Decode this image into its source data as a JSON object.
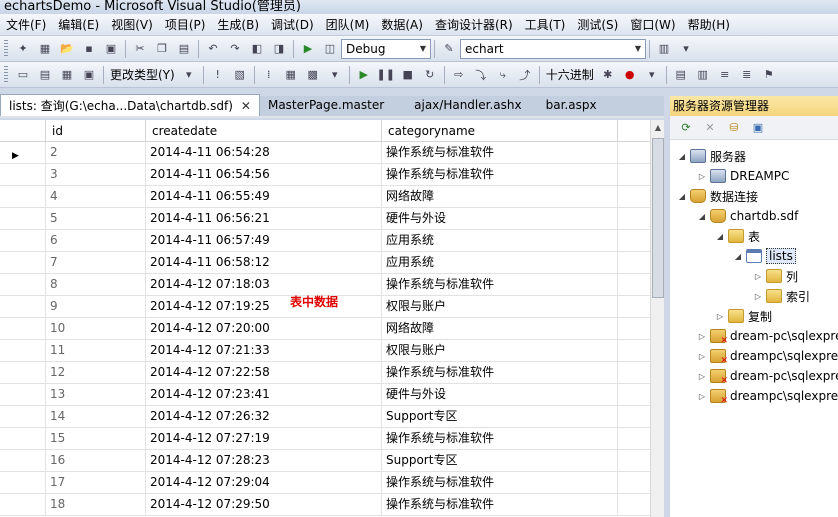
{
  "window": {
    "title": "echartsDemo - Microsoft Visual Studio(管理员)"
  },
  "menu": [
    "文件(F)",
    "编辑(E)",
    "视图(V)",
    "项目(P)",
    "生成(B)",
    "调试(D)",
    "团队(M)",
    "数据(A)",
    "查询设计器(R)",
    "工具(T)",
    "测试(S)",
    "窗口(W)",
    "帮助(H)"
  ],
  "toolbar1": {
    "config": "Debug",
    "search": "echart"
  },
  "toolbar2": {
    "change_type": "更改类型(Y)",
    "hex": "十六进制"
  },
  "tabs": [
    {
      "label": "lists: 查询(G:\\echa...Data\\chartdb.sdf)",
      "active": true,
      "close": "✕"
    },
    {
      "label": "MasterPage.master",
      "active": false
    },
    {
      "label": "ajax/Handler.ashx",
      "active": false
    },
    {
      "label": "bar.aspx",
      "active": false
    }
  ],
  "grid": {
    "columns": [
      "id",
      "createdate",
      "categoryname"
    ],
    "rows": [
      [
        "2",
        "2014-4-11 06:54:28",
        "操作系统与标准软件"
      ],
      [
        "3",
        "2014-4-11 06:54:56",
        "操作系统与标准软件"
      ],
      [
        "4",
        "2014-4-11 06:55:49",
        "网络故障"
      ],
      [
        "5",
        "2014-4-11 06:56:21",
        "硬件与外设"
      ],
      [
        "6",
        "2014-4-11 06:57:49",
        "应用系统"
      ],
      [
        "7",
        "2014-4-11 06:58:12",
        "应用系统"
      ],
      [
        "8",
        "2014-4-12 07:18:03",
        "操作系统与标准软件"
      ],
      [
        "9",
        "2014-4-12 07:19:25",
        "权限与账户"
      ],
      [
        "10",
        "2014-4-12 07:20:00",
        "网络故障"
      ],
      [
        "11",
        "2014-4-12 07:21:33",
        "权限与账户"
      ],
      [
        "12",
        "2014-4-12 07:22:58",
        "操作系统与标准软件"
      ],
      [
        "13",
        "2014-4-12 07:23:41",
        "硬件与外设"
      ],
      [
        "14",
        "2014-4-12 07:26:32",
        "Support专区"
      ],
      [
        "15",
        "2014-4-12 07:27:19",
        "操作系统与标准软件"
      ],
      [
        "16",
        "2014-4-12 07:28:23",
        "Support专区"
      ],
      [
        "17",
        "2014-4-12 07:29:04",
        "操作系统与标准软件"
      ],
      [
        "18",
        "2014-4-12 07:29:50",
        "操作系统与标准软件"
      ]
    ],
    "annotation": "表中数据"
  },
  "server_explorer": {
    "title": "服务器资源管理器",
    "nodes": [
      {
        "label": "服务器",
        "icon": "server-icon"
      },
      {
        "label": "DREAMPC",
        "icon": "computer-icon"
      },
      {
        "label": "数据连接",
        "icon": "data-connections-icon"
      },
      {
        "label": "chartdb.sdf",
        "icon": "database-icon"
      },
      {
        "label": "表",
        "icon": "folder-icon"
      },
      {
        "label": "lists",
        "icon": "table-icon"
      },
      {
        "label": "列",
        "icon": "folder-icon"
      },
      {
        "label": "索引",
        "icon": "folder-icon"
      },
      {
        "label": "复制",
        "icon": "folder-icon"
      },
      {
        "label": "dream-pc\\sqlexpress",
        "icon": "database-error-icon"
      },
      {
        "label": "dreampc\\sqlexpress",
        "icon": "database-error-icon"
      },
      {
        "label": "dream-pc\\sqlexpress",
        "icon": "database-error-icon"
      },
      {
        "label": "dreampc\\sqlexpress",
        "icon": "database-error-icon"
      }
    ]
  },
  "colors": {
    "accent": "#f5d57c",
    "annotation": "#e00000",
    "chrome": "#cfd8e6"
  }
}
